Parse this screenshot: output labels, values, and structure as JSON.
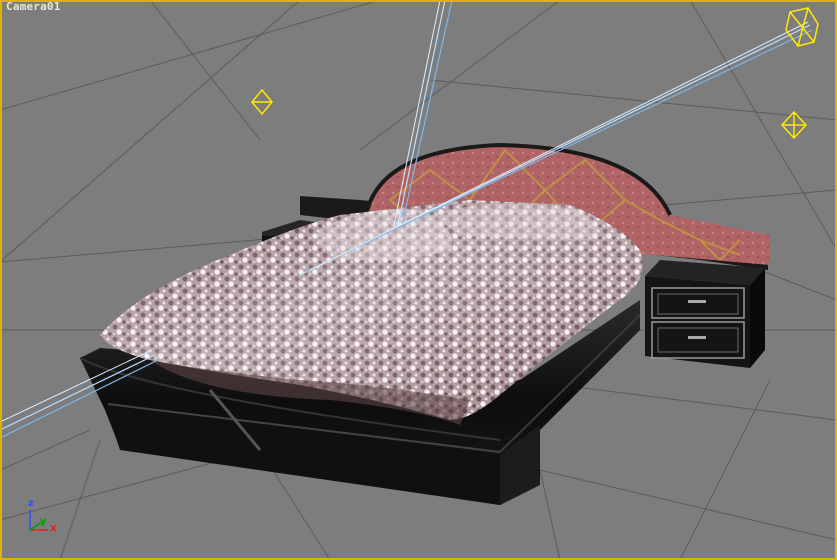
{
  "viewport": {
    "label": "Camera01",
    "border_color": "#d9b400",
    "background_color": "#7d7d7d"
  },
  "axis_gizmo": {
    "z_label": "z",
    "y_label": "y",
    "x_label": "x",
    "z_color": "#3050ff",
    "y_color": "#00a000",
    "x_color": "#e02020"
  },
  "scene": {
    "objects": [
      "bed",
      "headboard",
      "left-nightstand",
      "right-nightstand",
      "light-gizmos",
      "camera-lines",
      "home-grid"
    ]
  }
}
